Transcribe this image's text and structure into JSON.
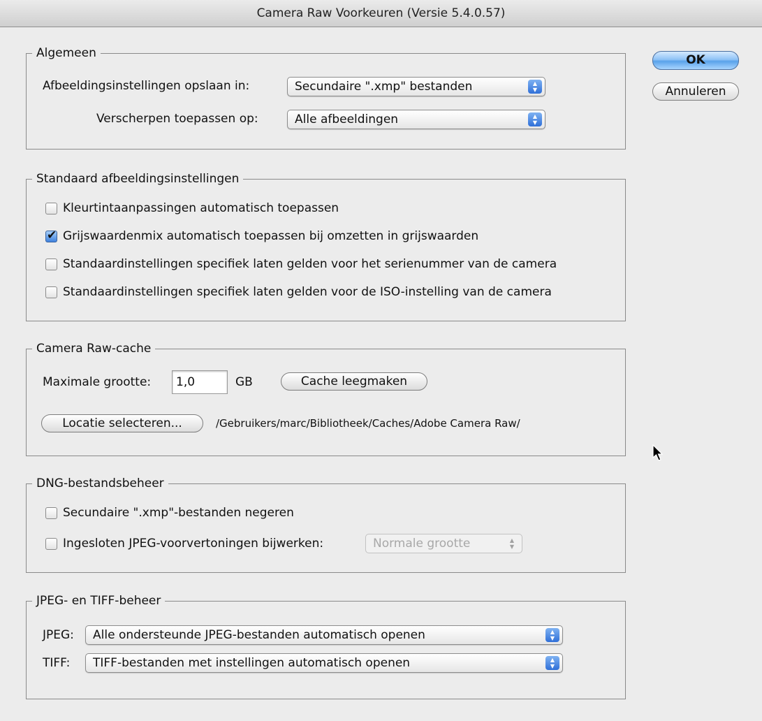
{
  "window": {
    "title": "Camera Raw Voorkeuren  (Versie 5.4.0.57)"
  },
  "buttons": {
    "ok": "OK",
    "cancel": "Annuleren"
  },
  "general": {
    "legend": "Algemeen",
    "save_label": "Afbeeldingsinstellingen opslaan in:",
    "save_value": "Secundaire \".xmp\" bestanden",
    "sharpen_label": "Verscherpen toepassen op:",
    "sharpen_value": "Alle afbeeldingen"
  },
  "defaults": {
    "legend": "Standaard afbeeldingsinstellingen",
    "options": [
      {
        "label": "Kleurtintaanpassingen automatisch toepassen",
        "checked": false
      },
      {
        "label": "Grijswaardenmix automatisch toepassen bij omzetten in grijswaarden",
        "checked": true
      },
      {
        "label": "Standaardinstellingen specifiek laten gelden voor het serienummer van de camera",
        "checked": false
      },
      {
        "label": "Standaardinstellingen specifiek laten gelden voor de ISO-instelling van de camera",
        "checked": false
      }
    ]
  },
  "cache": {
    "legend": "Camera Raw-cache",
    "max_size_label": "Maximale grootte:",
    "max_size_value": "1,0",
    "unit": "GB",
    "purge_button": "Cache leegmaken",
    "location_button": "Locatie selecteren...",
    "location_path": "/Gebruikers/marc/Bibliotheek/Caches/Adobe Camera Raw/"
  },
  "dng": {
    "legend": "DNG-bestandsbeheer",
    "ignore_xmp": "Secundaire \".xmp\"-bestanden negeren",
    "update_previews": "Ingesloten JPEG-voorvertoningen bijwerken:",
    "preview_size": "Normale grootte"
  },
  "jpeg_tiff": {
    "legend": "JPEG- en TIFF-beheer",
    "jpeg_label": "JPEG:",
    "jpeg_value": "Alle ondersteunde JPEG-bestanden automatisch openen",
    "tiff_label": "TIFF:",
    "tiff_value": "TIFF-bestanden met instellingen automatisch openen"
  },
  "icons": {
    "popup_arrows": "up-down-arrows-icon",
    "checkmark": "checkmark-icon",
    "cursor": "mouse-pointer-icon"
  }
}
